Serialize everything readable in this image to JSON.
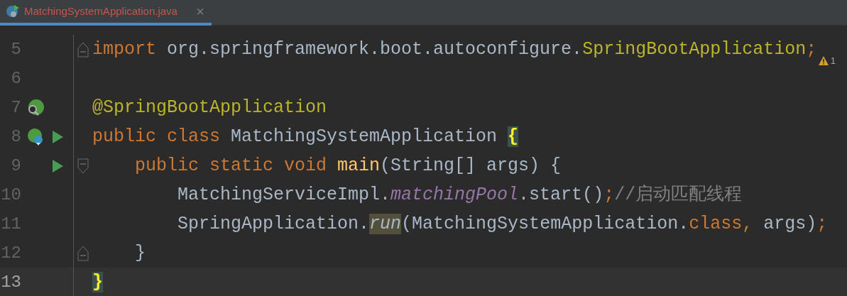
{
  "tab": {
    "title": "MatchingSystemApplication.java",
    "close": "×",
    "selected": true
  },
  "inspections": {
    "warnings": "1"
  },
  "lines": [
    {
      "number": "5",
      "current": false,
      "fold_marker": {
        "kind": "end"
      },
      "tokens": [
        {
          "text": "import",
          "kind": "keyword"
        },
        {
          "text": " org.springframework.boot.autoconfigure.",
          "kind": "plain"
        },
        {
          "text": "SpringBootApplication",
          "kind": "annotation"
        },
        {
          "text": ";",
          "kind": "keyword"
        }
      ]
    },
    {
      "number": "6",
      "current": false
    },
    {
      "number": "7",
      "current": false,
      "gutter": [
        {
          "kind": "spring-search"
        }
      ],
      "tokens": [
        {
          "text": "@SpringBootApplication",
          "kind": "annotation"
        }
      ]
    },
    {
      "number": "8",
      "current": false,
      "gutter": [
        {
          "kind": "spring-bean"
        },
        {
          "kind": "run"
        }
      ],
      "tokens": [
        {
          "text": "public class",
          "kind": "keyword"
        },
        {
          "text": " MatchingSystemApplication ",
          "kind": "plain"
        },
        {
          "text": "{",
          "kind": "brace-match"
        }
      ]
    },
    {
      "number": "9",
      "current": false,
      "gutter": [
        {
          "kind": "run"
        }
      ],
      "fold_marker": {
        "kind": "start"
      },
      "tokens": [
        {
          "text": "    public static void",
          "kind": "keyword"
        },
        {
          "text": " main",
          "kind": "method"
        },
        {
          "text": "(String[] args) {",
          "kind": "plain"
        }
      ]
    },
    {
      "number": "10",
      "current": false,
      "tokens": [
        {
          "text": "        MatchingServiceImpl.",
          "kind": "plain"
        },
        {
          "text": "matchingPool",
          "kind": "static-field"
        },
        {
          "text": ".start()",
          "kind": "plain"
        },
        {
          "text": ";",
          "kind": "keyword"
        },
        {
          "text": "//启动匹配线程",
          "kind": "comment"
        }
      ]
    },
    {
      "number": "11",
      "current": false,
      "tokens": [
        {
          "text": "        SpringApplication.",
          "kind": "plain"
        },
        {
          "text": "run",
          "kind": "usage-static-call"
        },
        {
          "text": "(MatchingSystemApplication.",
          "kind": "plain"
        },
        {
          "text": "class",
          "kind": "keyword"
        },
        {
          "text": ", ",
          "kind": "keyword"
        },
        {
          "text": "args)",
          "kind": "plain"
        },
        {
          "text": ";",
          "kind": "keyword"
        }
      ]
    },
    {
      "number": "12",
      "current": false,
      "fold_marker": {
        "kind": "end"
      },
      "tokens": [
        {
          "text": "    }",
          "kind": "plain"
        }
      ]
    },
    {
      "number": "13",
      "current": true,
      "tokens": [
        {
          "text": "}",
          "kind": "brace-match"
        }
      ]
    }
  ]
}
